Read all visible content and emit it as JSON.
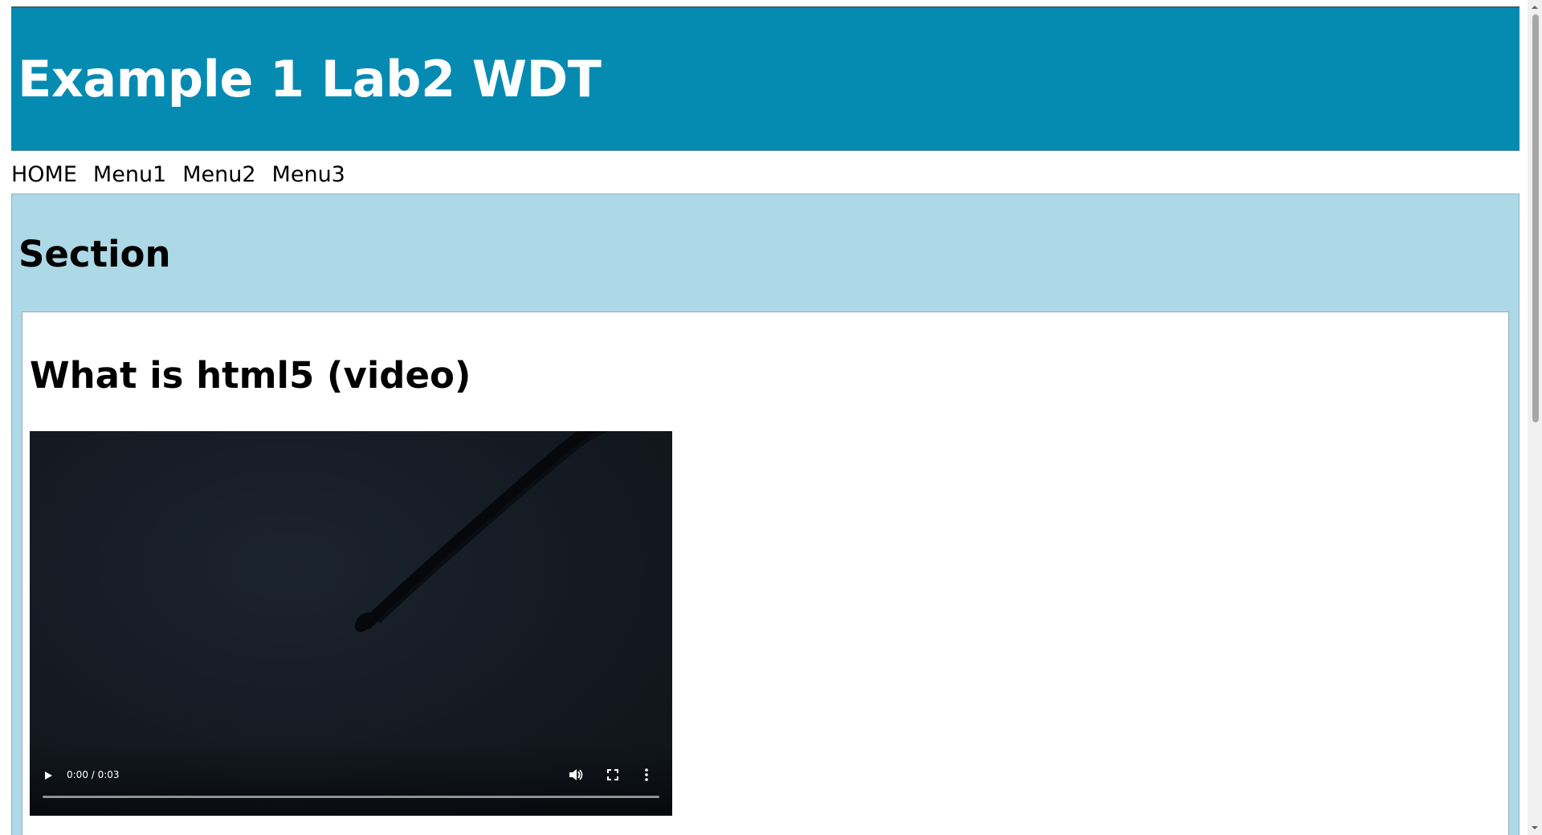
{
  "header": {
    "title": "Example 1 Lab2 WDT",
    "background_color": "#058bb2"
  },
  "nav": {
    "items": [
      {
        "label": "HOME"
      },
      {
        "label": "Menu1"
      },
      {
        "label": "Menu2"
      },
      {
        "label": "Menu3"
      }
    ]
  },
  "section": {
    "heading": "Section",
    "background_color": "#add8e6",
    "article": {
      "heading": "What is html5 (video)",
      "video": {
        "time_display": "0:00 / 0:03",
        "progress_fraction": 0,
        "controls": [
          "play-icon",
          "volume-icon",
          "fullscreen-icon",
          "more-options-icon"
        ]
      }
    }
  },
  "scrollbar": {
    "thumb_color": "#a6a6a6"
  }
}
